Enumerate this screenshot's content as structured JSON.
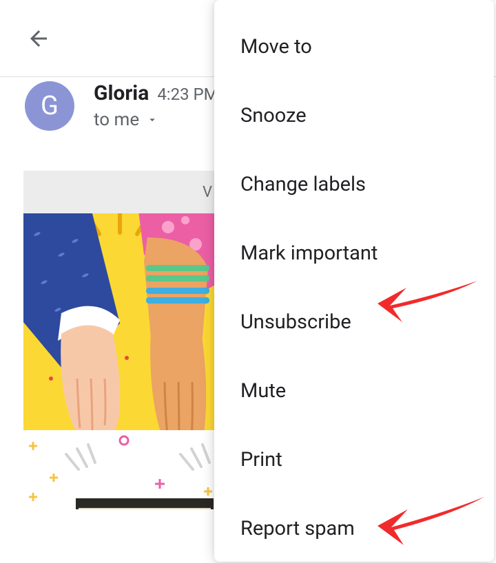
{
  "topbar": {
    "back": "Back"
  },
  "email": {
    "avatar_letter": "G",
    "sender_name": "Gloria",
    "time": "4:23 PM",
    "recipient": "to me",
    "banner_text": "V"
  },
  "menu": {
    "items": [
      {
        "label": "Move to"
      },
      {
        "label": "Snooze"
      },
      {
        "label": "Change labels"
      },
      {
        "label": "Mark important"
      },
      {
        "label": "Unsubscribe"
      },
      {
        "label": "Mute"
      },
      {
        "label": "Print"
      },
      {
        "label": "Report spam"
      }
    ]
  }
}
